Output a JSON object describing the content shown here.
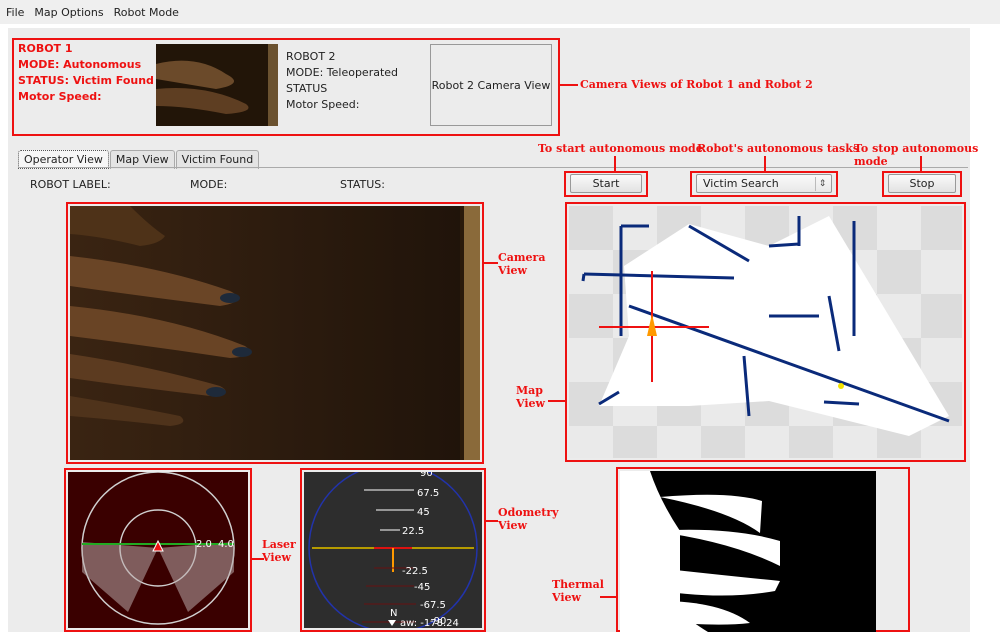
{
  "menu": [
    "File",
    "Map Options",
    "Robot Mode"
  ],
  "robot1": {
    "name": "ROBOT 1",
    "mode": "MODE: Autonomous",
    "status": "STATUS: Victim Found",
    "speed": "Motor Speed:"
  },
  "robot2": {
    "name": "ROBOT 2",
    "mode": "MODE: Teleoperated",
    "status": "STATUS",
    "speed": "Motor Speed:",
    "camera_placeholder": "Robot 2 Camera View"
  },
  "tabs": [
    "Operator View",
    "Map View",
    "Victim Found"
  ],
  "status_row": {
    "label": "ROBOT LABEL:",
    "mode": "MODE:",
    "status": "STATUS:"
  },
  "controls": {
    "start": "Start",
    "task": "Victim Search",
    "stop": "Stop"
  },
  "laser": {
    "ring_labels": [
      "2.0",
      "4.0"
    ]
  },
  "odometry": {
    "ticks": [
      "90",
      "67.5",
      "45",
      "22.5",
      "-22.5",
      "-45",
      "-67.5",
      "-90"
    ],
    "north": "N",
    "yaw": "aw: -178.24"
  },
  "annotations": {
    "cam_views": "Camera Views of Robot 1 and Robot 2",
    "start": "To start autonomous mode",
    "tasks": "Robot's autonomous tasks",
    "stop": "To stop autonomous mode",
    "camera": [
      "Camera",
      "View"
    ],
    "map": [
      "Map",
      "View"
    ],
    "laser": [
      "Laser",
      "View"
    ],
    "odometry": [
      "Odometry",
      "View"
    ],
    "thermal": [
      "Thermal",
      "View"
    ]
  },
  "colors": {
    "annotation": "#ee1111",
    "robot1_text": "#ee1111",
    "laser_bg": "#3a0000",
    "odometry_bg": "#2d2d2d",
    "map_wall": "#0a2a7a",
    "heading": "#ff9900"
  }
}
